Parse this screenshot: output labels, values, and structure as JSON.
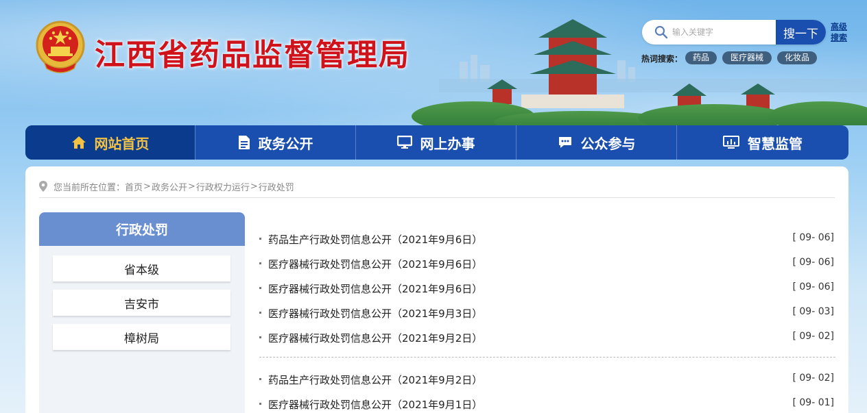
{
  "header": {
    "site_title": "江西省药品监督管理局",
    "search": {
      "placeholder": "输入关键字",
      "button_label": "搜一下",
      "advanced_label": "高级搜索"
    },
    "hot_search": {
      "label": "热词搜索：",
      "tags": [
        "药品",
        "医疗器械",
        "化妆品"
      ]
    }
  },
  "nav": {
    "items": [
      {
        "label": "网站首页",
        "icon": "home-icon",
        "active": true
      },
      {
        "label": "政务公开",
        "icon": "document-icon",
        "active": false
      },
      {
        "label": "网上办事",
        "icon": "monitor-icon",
        "active": false
      },
      {
        "label": "公众参与",
        "icon": "chat-icon",
        "active": false
      },
      {
        "label": "智慧监管",
        "icon": "dashboard-icon",
        "active": false
      }
    ]
  },
  "breadcrumb": {
    "prefix": "您当前所在位置：",
    "items": [
      "首页",
      "政务公开",
      "行政权力运行",
      "行政处罚"
    ],
    "separator": ">"
  },
  "sidebar": {
    "title": "行政处罚",
    "items": [
      "省本级",
      "吉安市",
      "樟树局"
    ]
  },
  "list": {
    "group1": [
      {
        "title": "药品生产行政处罚信息公开（2021年9月6日）",
        "date": "[ 09- 06]"
      },
      {
        "title": "医疗器械行政处罚信息公开（2021年9月6日）",
        "date": "[ 09- 06]"
      },
      {
        "title": "医疗器械行政处罚信息公开（2021年9月6日）",
        "date": "[ 09- 06]"
      },
      {
        "title": "医疗器械行政处罚信息公开（2021年9月3日）",
        "date": "[ 09- 03]"
      },
      {
        "title": "医疗器械行政处罚信息公开（2021年9月2日）",
        "date": "[ 09- 02]"
      }
    ],
    "group2": [
      {
        "title": "药品生产行政处罚信息公开（2021年9月2日）",
        "date": "[ 09- 02]"
      },
      {
        "title": "医疗器械行政处罚信息公开（2021年9月1日）",
        "date": "[ 09- 01]"
      }
    ]
  },
  "colors": {
    "title_red": "#d0121b",
    "nav_blue": "#1a4fb0",
    "nav_active": "#0b3b8c",
    "nav_active_text": "#f3c245",
    "sidebar_head": "#6a8fd0"
  }
}
